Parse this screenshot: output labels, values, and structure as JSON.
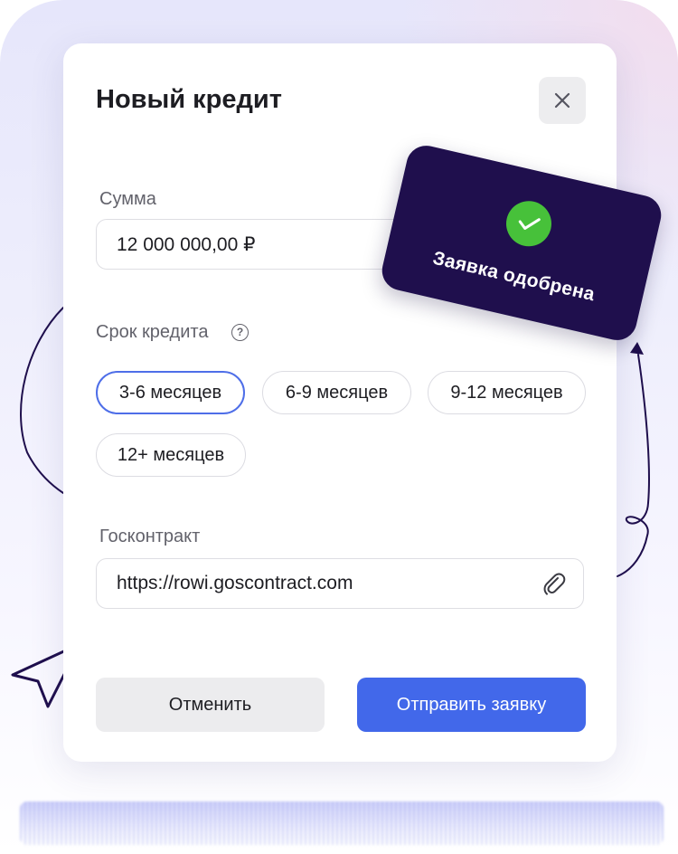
{
  "modal": {
    "title": "Новый кредит",
    "close_icon": "close-icon"
  },
  "amount": {
    "label": "Сумма",
    "value": "12 000 000,00 ₽"
  },
  "term": {
    "label": "Срок кредита",
    "help_icon": "question-circle-icon",
    "options": [
      "3-6 месяцев",
      "6-9 месяцев",
      "9-12 месяцев",
      "12+ месяцев"
    ],
    "selected": "3-6 месяцев"
  },
  "contract": {
    "label": "Госконтракт",
    "value": "https://rowi.goscontract.com",
    "attach_icon": "paperclip-icon"
  },
  "actions": {
    "cancel_label": "Отменить",
    "submit_label": "Отправить заявку"
  },
  "toast": {
    "text": "Заявка одобрена",
    "icon": "check-circle-icon"
  },
  "colors": {
    "accent": "#4268ea",
    "selected_border": "#4e6ee8",
    "toast_bg": "#1f0f4d",
    "success": "#47c13a"
  }
}
